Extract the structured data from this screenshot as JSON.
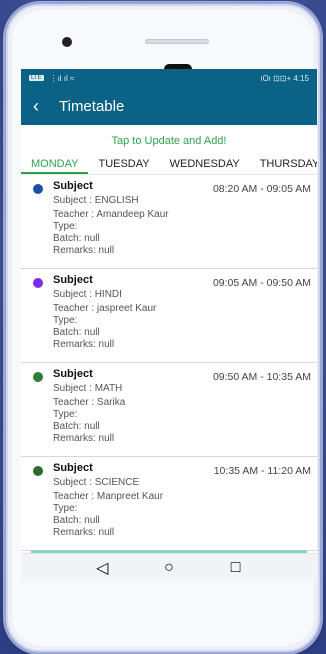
{
  "statusbar": {
    "left_badge": "LTE",
    "left_signal": "⋮ıl ıl ≈",
    "right": "ıOı ⊡⊡+ 4:15"
  },
  "appbar": {
    "back": "‹",
    "title": "Timetable"
  },
  "update_text": "Tap to Update and Add!",
  "tabs": [
    "MONDAY",
    "TUESDAY",
    "WEDNESDAY",
    "THURSDAY"
  ],
  "active_tab": "MONDAY",
  "entries": [
    {
      "color": "#1e4fa8",
      "title": "Subject",
      "subject": "Subject : ENGLISH",
      "teacher": "Teacher : Amandeep Kaur",
      "type": "Type:",
      "batch": "Batch: null",
      "remarks": "Remarks: null",
      "time": "08:20 AM - 09:05 AM"
    },
    {
      "color": "#7a2cf0",
      "title": "Subject",
      "subject": "Subject : HINDI",
      "teacher": "Teacher : jaspreet Kaur",
      "type": "Type:",
      "batch": "Batch: null",
      "remarks": "Remarks: null",
      "time": "09:05 AM - 09:50 AM"
    },
    {
      "color": "#2e7d32",
      "title": "Subject",
      "subject": "Subject : MATH",
      "teacher": "Teacher : Sarika",
      "type": "Type:",
      "batch": "Batch: null",
      "remarks": "Remarks: null",
      "time": "09:50 AM - 10:35 AM"
    },
    {
      "color": "#2e6b2a",
      "title": "Subject",
      "subject": "Subject : SCIENCE",
      "teacher": "Teacher : Manpreet Kaur",
      "type": "Type:",
      "batch": "Batch: null",
      "remarks": "Remarks: null",
      "time": "10:35 AM - 11:20 AM"
    }
  ],
  "navbar": {
    "back": "◁",
    "home": "○",
    "recents": "□"
  }
}
